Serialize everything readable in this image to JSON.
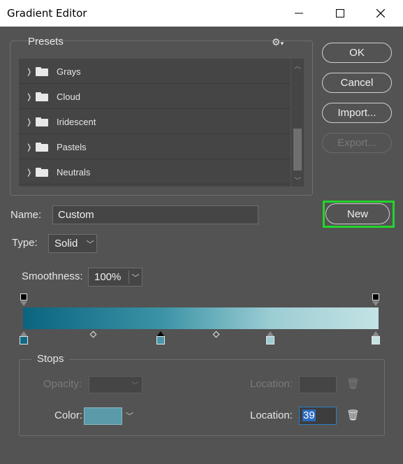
{
  "window": {
    "title": "Gradient Editor"
  },
  "presets": {
    "label": "Presets",
    "settings_icon": "gear-icon",
    "items": [
      {
        "label": "Grays"
      },
      {
        "label": "Cloud"
      },
      {
        "label": "Iridescent"
      },
      {
        "label": "Pastels"
      },
      {
        "label": "Neutrals"
      }
    ]
  },
  "buttons": {
    "ok": "OK",
    "cancel": "Cancel",
    "import": "Import...",
    "export": "Export...",
    "new": "New"
  },
  "name": {
    "label": "Name:",
    "value": "Custom"
  },
  "type": {
    "label": "Type:",
    "value": "Solid"
  },
  "smoothness": {
    "label": "Smoothness:",
    "value": "100%"
  },
  "gradient": {
    "colors": [
      "#0a6480",
      "#3b93a6",
      "#9ccdd4",
      "#c4e3e4"
    ],
    "color_stops": [
      {
        "location": 0,
        "color": "#116a85"
      },
      {
        "location": 39,
        "color": "#4a97a9",
        "selected": true
      },
      {
        "location": 70,
        "color": "#9ccdd4"
      },
      {
        "location": 100,
        "color": "#c4e3e4"
      }
    ],
    "opacity_stops": [
      {
        "location": 0
      },
      {
        "location": 100
      }
    ]
  },
  "stops": {
    "label": "Stops",
    "opacity_label": "Opacity:",
    "opacity_location_label": "Location:",
    "color_label": "Color:",
    "color_location_label": "Location:",
    "color_location_value": "39",
    "color_value": "#5b9ba9"
  }
}
